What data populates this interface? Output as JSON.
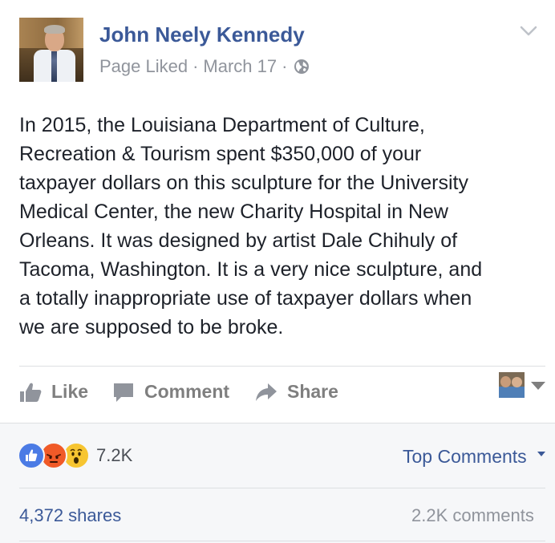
{
  "post": {
    "author": "John Neely Kennedy",
    "meta": {
      "context": "Page Liked",
      "separator": "·",
      "date": "March 17",
      "privacy_icon": "globe-icon"
    },
    "text": "In 2015, the Louisiana Department of Culture,\nRecreation & Tourism spent $350,000 of your\ntaxpayer dollars on this sculpture for the University\nMedical Center, the new Charity Hospital in New\nOrleans. It was designed by artist Dale Chihuly of\nTacoma, Washington. It is a very nice sculpture, and\na totally inappropriate use of taxpayer dollars when\nwe are supposed to be broke."
  },
  "actions": {
    "like_label": "Like",
    "comment_label": "Comment",
    "share_label": "Share"
  },
  "stats": {
    "reactions_count": "7.2K",
    "reaction_types": [
      "like-icon",
      "angry-icon",
      "wow-icon"
    ],
    "top_comments_label": "Top Comments",
    "shares_label": "4,372 shares",
    "comments_label": "2.2K comments"
  },
  "colors": {
    "brand_blue": "#3b5998",
    "meta_gray": "#90949c",
    "like_blue": "#4b7be5",
    "angry_orange": "#f05a28",
    "wow_yellow": "#f7c531"
  }
}
